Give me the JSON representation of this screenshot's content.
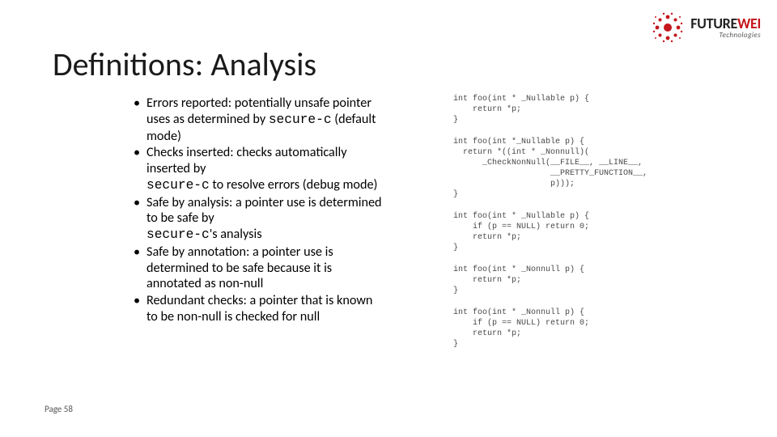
{
  "title": "Definitions: Analysis",
  "logo": {
    "future": "FUTURE",
    "wei": "WEI",
    "sub": "Technologies"
  },
  "bullets": [
    {
      "pre": "Errors reported: potentially unsafe pointer uses as determined by ",
      "code": "secure-c",
      "post": " (default mode)"
    },
    {
      "pre": "Checks inserted: checks automatically inserted by",
      "br": true,
      "code": "secure-c",
      "post": " to resolve errors (debug mode)"
    },
    {
      "pre": "Safe by analysis: a pointer use is determined to be safe by",
      "br": true,
      "code": "secure-c",
      "post": "'s analysis"
    },
    {
      "pre": "Safe by annotation: a pointer use is determined to be safe because it is annotated as non-null",
      "code": "",
      "post": ""
    },
    {
      "pre": "Redundant checks: a pointer that is known to be non-null is checked for null",
      "code": "",
      "post": ""
    }
  ],
  "snippets": [
    "int foo(int * _Nullable p) {\n    return *p;\n}",
    "int foo(int *_Nullable p) {\n  return *((int * _Nonnull)(\n      _CheckNonNull(__FILE__, __LINE__,\n                    __PRETTY_FUNCTION__,\n                    p)));\n}",
    "int foo(int * _Nullable p) {\n    if (p == NULL) return 0;\n    return *p;\n}",
    "int foo(int * _Nonnull p) {\n    return *p;\n}",
    "int foo(int * _Nonnull p) {\n    if (p == NULL) return 0;\n    return *p;\n}"
  ],
  "page": "Page 58"
}
